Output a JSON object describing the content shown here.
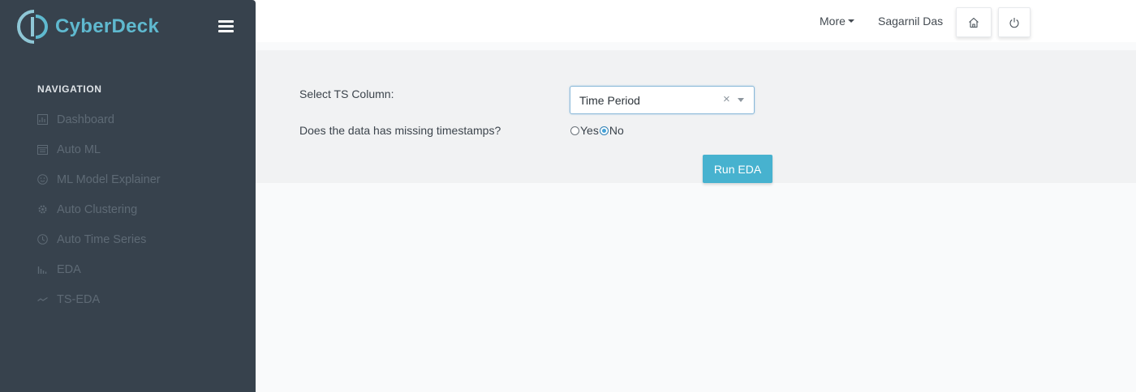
{
  "brand": {
    "name": "CyberDeck",
    "accent": "#5fb9cf"
  },
  "sidebar": {
    "heading": "NAVIGATION",
    "items": [
      {
        "label": "Dashboard",
        "icon": "dashboard-icon"
      },
      {
        "label": "Auto ML",
        "icon": "calendar-grid-icon"
      },
      {
        "label": "ML Model Explainer",
        "icon": "smile-icon"
      },
      {
        "label": "Auto Clustering",
        "icon": "settings-icon"
      },
      {
        "label": "Auto Time Series",
        "icon": "clock-icon"
      },
      {
        "label": "EDA",
        "icon": "bar-chart-icon"
      },
      {
        "label": "TS-EDA",
        "icon": "trend-line-icon"
      }
    ]
  },
  "topbar": {
    "more_label": "More",
    "user_name": "Sagarnil Das",
    "home_icon": "home-icon",
    "power_icon": "power-icon"
  },
  "form": {
    "ts_column_label": "Select TS Column:",
    "ts_column_value": "Time Period",
    "missing_label": "Does the data has missing timestamps?",
    "options": [
      {
        "label": "Yes",
        "checked": false
      },
      {
        "label": "No",
        "checked": true
      }
    ],
    "run_label": "Run EDA",
    "run_color": "#47b2cf"
  }
}
